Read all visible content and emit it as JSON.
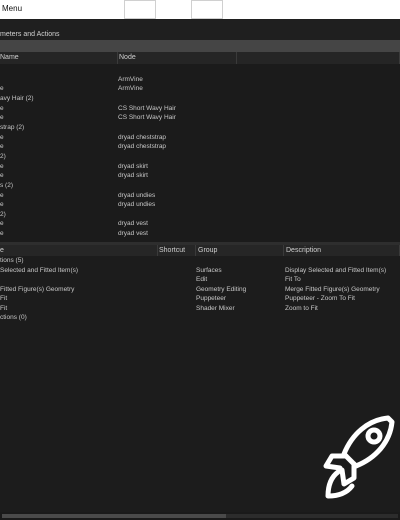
{
  "window": {
    "title": "Menu"
  },
  "search": {
    "label": "meters and Actions",
    "value": ""
  },
  "params_table": {
    "headers": [
      "Name",
      "Node"
    ],
    "rows": [
      {
        "name": "",
        "node": "ArmVine"
      },
      {
        "name": "e",
        "node": "ArmVine"
      },
      {
        "name": "avy Hair (2)",
        "node": ""
      },
      {
        "name": "e",
        "node": "CS Short Wavy Hair"
      },
      {
        "name": "e",
        "node": "CS Short Wavy Hair"
      },
      {
        "name": "strap (2)",
        "node": ""
      },
      {
        "name": "e",
        "node": "dryad cheststrap"
      },
      {
        "name": "e",
        "node": "dryad cheststrap"
      },
      {
        "name": "2)",
        "node": ""
      },
      {
        "name": "e",
        "node": "dryad skirt"
      },
      {
        "name": "e",
        "node": "dryad skirt"
      },
      {
        "name": "s (2)",
        "node": ""
      },
      {
        "name": "e",
        "node": "dryad undies"
      },
      {
        "name": "e",
        "node": "dryad undies"
      },
      {
        "name": "2)",
        "node": ""
      },
      {
        "name": "e",
        "node": "dryad vest"
      },
      {
        "name": "e",
        "node": "dryad vest"
      }
    ]
  },
  "actions_table": {
    "headers": [
      "e",
      "Shortcut",
      "Group",
      "Description"
    ],
    "rows": [
      {
        "name": "tions (5)",
        "shortcut": "",
        "group": "",
        "description": ""
      },
      {
        "name": "Selected and Fitted Item(s)",
        "shortcut": "",
        "group": "Surfaces",
        "description": "Display Selected and Fitted Item(s)"
      },
      {
        "name": "",
        "shortcut": "",
        "group": "Edit",
        "description": "Fit To"
      },
      {
        "name": "Fitted Figure(s) Geometry",
        "shortcut": "",
        "group": "Geometry Editing",
        "description": "Merge Fitted Figure(s) Geometry"
      },
      {
        "name": "Fit",
        "shortcut": "",
        "group": "Puppeteer",
        "description": "Puppeteer - Zoom To Fit"
      },
      {
        "name": "Fit",
        "shortcut": "",
        "group": "Shader Mixer",
        "description": "Zoom to Fit"
      },
      {
        "name": "ctions (0)",
        "shortcut": "",
        "group": "",
        "description": ""
      }
    ]
  },
  "colors": {
    "background": "#1f1f1f",
    "header": "#252525",
    "search": "#454545",
    "text": "#c8c8c8"
  },
  "icons": [
    "rocket-icon"
  ]
}
